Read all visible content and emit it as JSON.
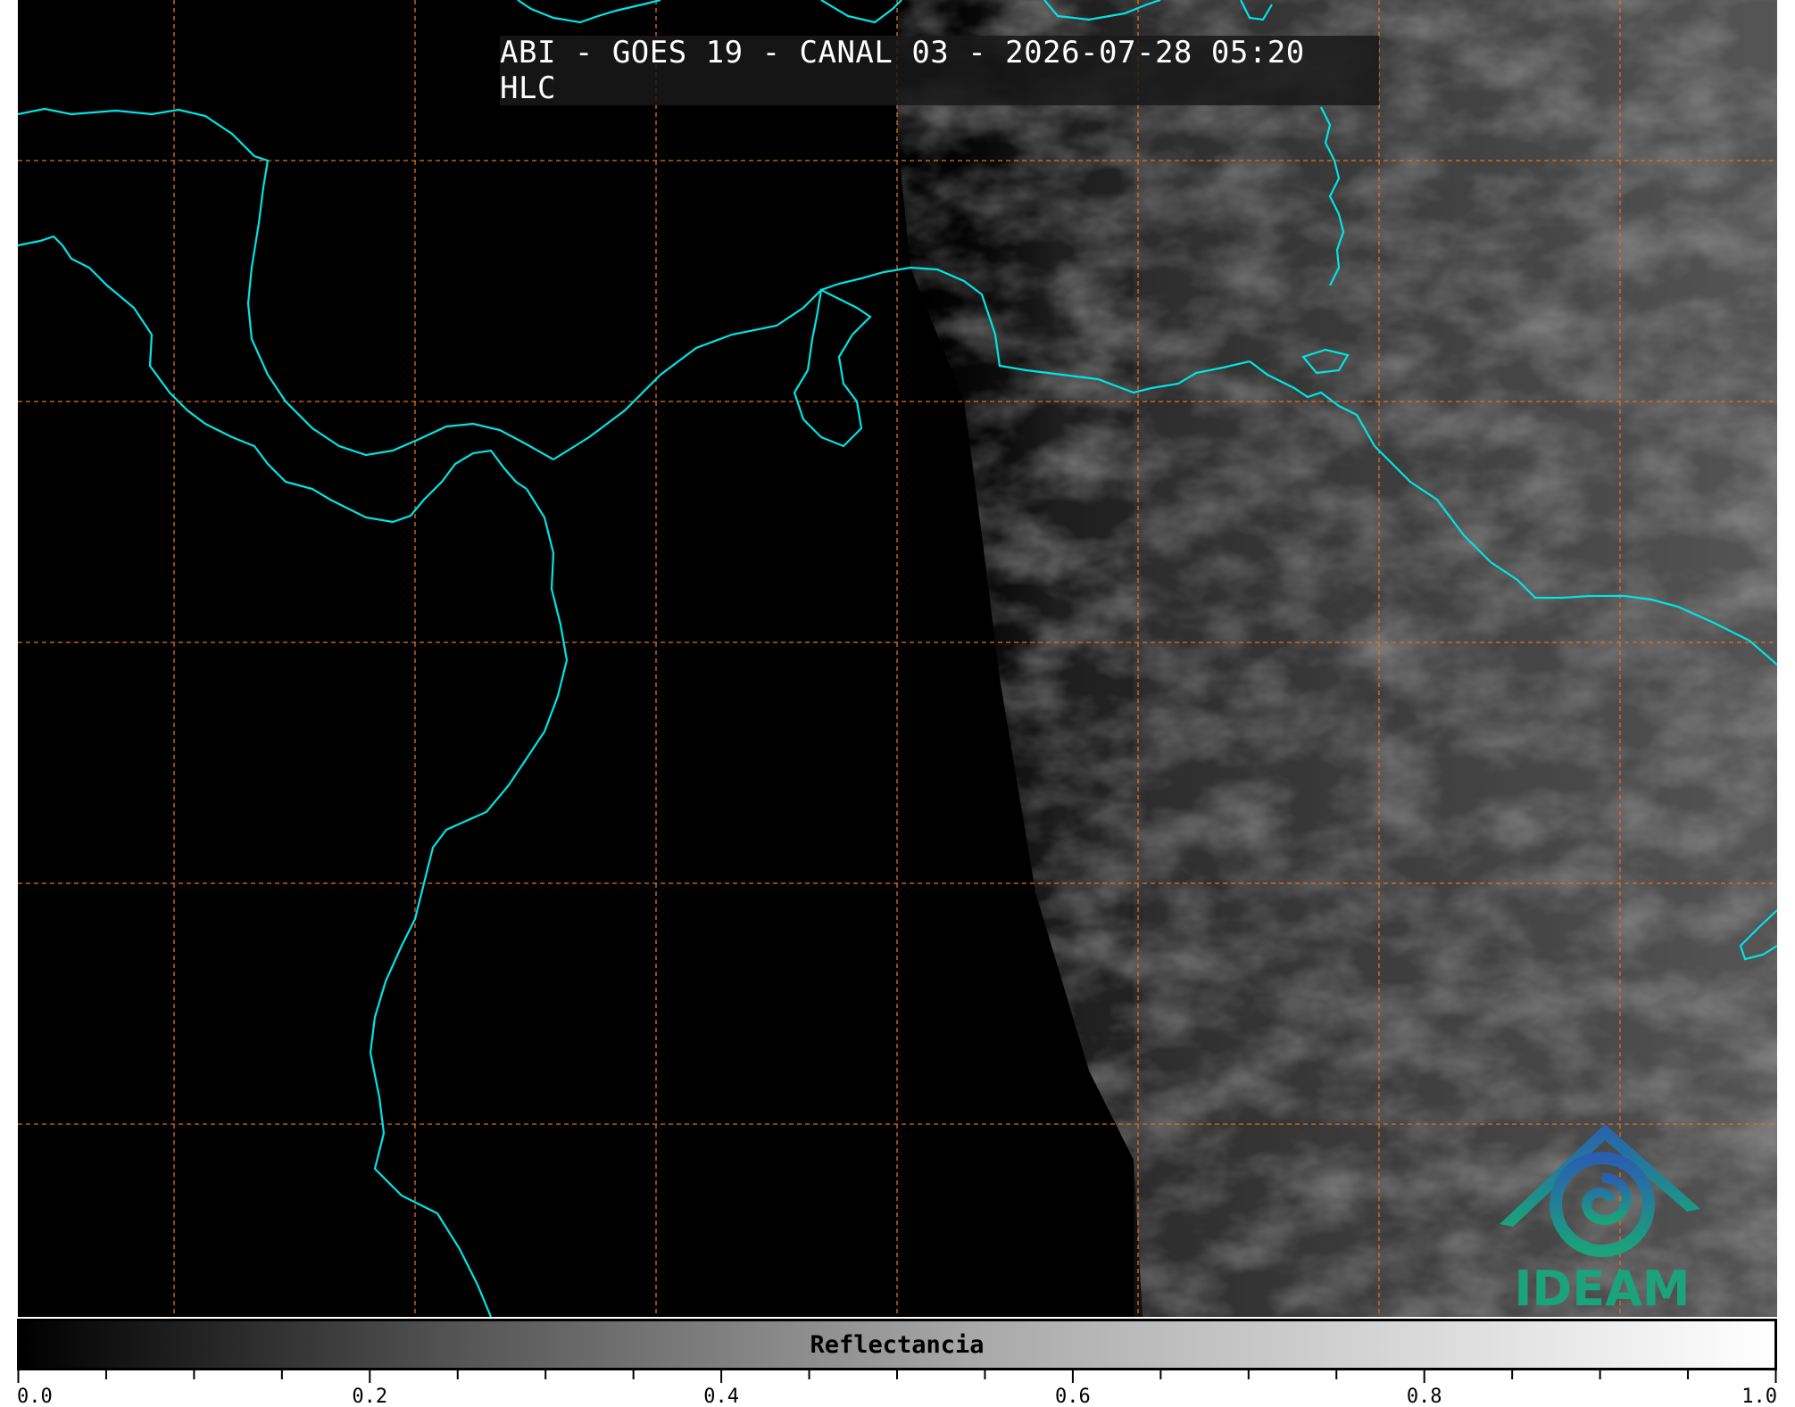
{
  "title": "ABI - GOES 19 - CANAL 03 - 2026-07-28 05:20 HLC",
  "logo": {
    "text": "IDEAM",
    "icon": "ideam-mountain-spiral-logo"
  },
  "colorbar": {
    "label": "Reflectancia",
    "min": 0.0,
    "max": 1.0,
    "tick_labels": [
      "0.0",
      "0.2",
      "0.4",
      "0.6",
      "0.8",
      "1.0"
    ],
    "colors": [
      "#000000",
      "#ffffff"
    ]
  },
  "map": {
    "coastline_color": "#00e5e5",
    "gridline_color": "#e07020",
    "gridline_style": "dashed"
  }
}
